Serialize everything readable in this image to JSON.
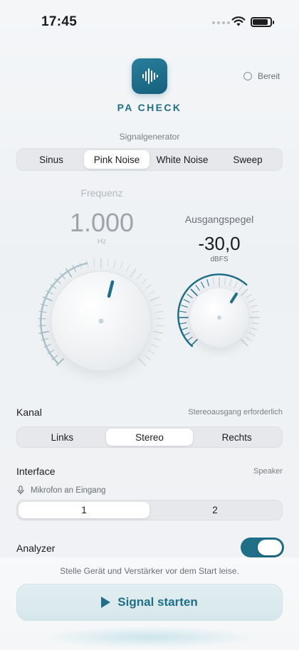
{
  "status_bar": {
    "time": "17:45"
  },
  "header": {
    "app_name": "PA CHECK",
    "app_icon": "waveform-icon",
    "status_label": "Bereit",
    "accent_color": "#1f6f88"
  },
  "signal_generator": {
    "label": "Signalgenerator",
    "options": [
      "Sinus",
      "Pink Noise",
      "White Noise",
      "Sweep"
    ],
    "selected": "Pink Noise"
  },
  "frequency": {
    "label": "Frequenz",
    "value": "1.000",
    "unit": "Hz",
    "enabled": false
  },
  "output_level": {
    "label": "Ausgangspegel",
    "value": "-30,0",
    "unit": "dBFS"
  },
  "channel": {
    "label": "Kanal",
    "note": "Stereoausgang erforderlich",
    "options": [
      "Links",
      "Stereo",
      "Rechts"
    ],
    "selected": "Stereo"
  },
  "interface": {
    "label": "Interface",
    "value": "Speaker",
    "mic_label": "Mikrofon an Eingang",
    "inputs": [
      "1",
      "2"
    ],
    "selected_input": "1"
  },
  "analyzer": {
    "label": "Analyzer",
    "enabled": true
  },
  "footer": {
    "hint": "Stelle Gerät und Verstärker vor dem Start leise.",
    "start_label": "Signal starten"
  }
}
